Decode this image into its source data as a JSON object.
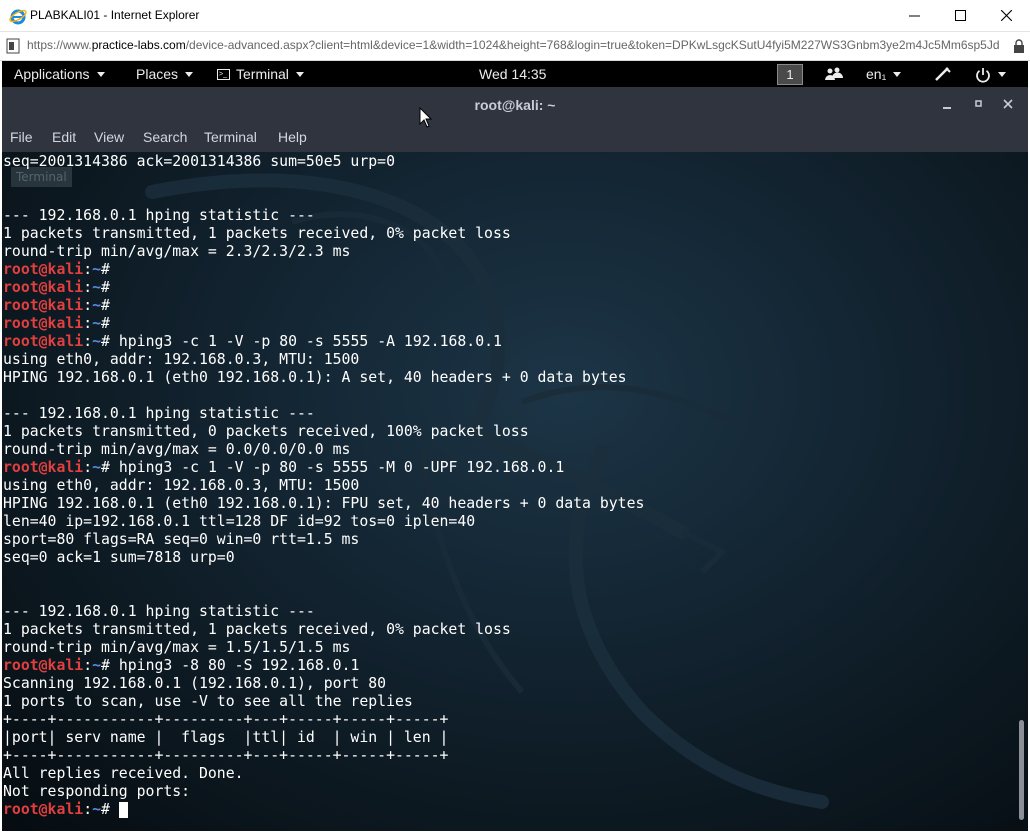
{
  "ie": {
    "title": "PLABKALI01 - Internet Explorer",
    "url_prefix": "https://www.",
    "url_domain": "practice-labs.com",
    "url_rest": "/device-advanced.aspx?client=html&device=1&width=1024&height=768&login=true&token=DPKwLsgcKSutU4fyi5M227WS3Gnbm3ye2m4Jc5Mm6sp5Jd"
  },
  "panel": {
    "applications": "Applications",
    "places": "Places",
    "terminal": "Terminal",
    "clock": "Wed 14:35",
    "workspace": "1",
    "language": "en₁"
  },
  "terminal": {
    "title": "root@kali: ~",
    "tooltip": "Terminal",
    "menu": [
      "File",
      "Edit",
      "View",
      "Search",
      "Terminal",
      "Help"
    ],
    "prompt": {
      "user": "root@kali",
      "path": "~",
      "symbol": "# "
    },
    "lines": [
      {
        "type": "out",
        "text": "seq=2001314386 ack=2001314386 sum=50e5 urp=0"
      },
      {
        "type": "out",
        "text": ""
      },
      {
        "type": "out",
        "text": ""
      },
      {
        "type": "out",
        "text": "--- 192.168.0.1 hping statistic ---"
      },
      {
        "type": "out",
        "text": "1 packets transmitted, 1 packets received, 0% packet loss"
      },
      {
        "type": "out",
        "text": "round-trip min/avg/max = 2.3/2.3/2.3 ms"
      },
      {
        "type": "prompt",
        "text": ""
      },
      {
        "type": "prompt",
        "text": ""
      },
      {
        "type": "prompt",
        "text": ""
      },
      {
        "type": "prompt",
        "text": ""
      },
      {
        "type": "prompt",
        "text": "hping3 -c 1 -V -p 80 -s 5555 -A 192.168.0.1"
      },
      {
        "type": "out",
        "text": "using eth0, addr: 192.168.0.3, MTU: 1500"
      },
      {
        "type": "out",
        "text": "HPING 192.168.0.1 (eth0 192.168.0.1): A set, 40 headers + 0 data bytes"
      },
      {
        "type": "out",
        "text": ""
      },
      {
        "type": "out",
        "text": "--- 192.168.0.1 hping statistic ---"
      },
      {
        "type": "out",
        "text": "1 packets transmitted, 0 packets received, 100% packet loss"
      },
      {
        "type": "out",
        "text": "round-trip min/avg/max = 0.0/0.0/0.0 ms"
      },
      {
        "type": "prompt",
        "text": "hping3 -c 1 -V -p 80 -s 5555 -M 0 -UPF 192.168.0.1"
      },
      {
        "type": "out",
        "text": "using eth0, addr: 192.168.0.3, MTU: 1500"
      },
      {
        "type": "out",
        "text": "HPING 192.168.0.1 (eth0 192.168.0.1): FPU set, 40 headers + 0 data bytes"
      },
      {
        "type": "out",
        "text": "len=40 ip=192.168.0.1 ttl=128 DF id=92 tos=0 iplen=40"
      },
      {
        "type": "out",
        "text": "sport=80 flags=RA seq=0 win=0 rtt=1.5 ms"
      },
      {
        "type": "out",
        "text": "seq=0 ack=1 sum=7818 urp=0"
      },
      {
        "type": "out",
        "text": ""
      },
      {
        "type": "out",
        "text": ""
      },
      {
        "type": "out",
        "text": "--- 192.168.0.1 hping statistic ---"
      },
      {
        "type": "out",
        "text": "1 packets transmitted, 1 packets received, 0% packet loss"
      },
      {
        "type": "out",
        "text": "round-trip min/avg/max = 1.5/1.5/1.5 ms"
      },
      {
        "type": "prompt",
        "text": "hping3 -8 80 -S 192.168.0.1"
      },
      {
        "type": "out",
        "text": "Scanning 192.168.0.1 (192.168.0.1), port 80"
      },
      {
        "type": "out",
        "text": "1 ports to scan, use -V to see all the replies"
      },
      {
        "type": "out",
        "text": "+----+-----------+---------+---+-----+-----+-----+"
      },
      {
        "type": "out",
        "text": "|port| serv name |  flags  |ttl| id  | win | len |"
      },
      {
        "type": "out",
        "text": "+----+-----------+---------+---+-----+-----+-----+"
      },
      {
        "type": "out",
        "text": "All replies received. Done."
      },
      {
        "type": "out",
        "text": "Not responding ports:"
      },
      {
        "type": "prompt",
        "text": "",
        "cursor": true
      }
    ]
  }
}
